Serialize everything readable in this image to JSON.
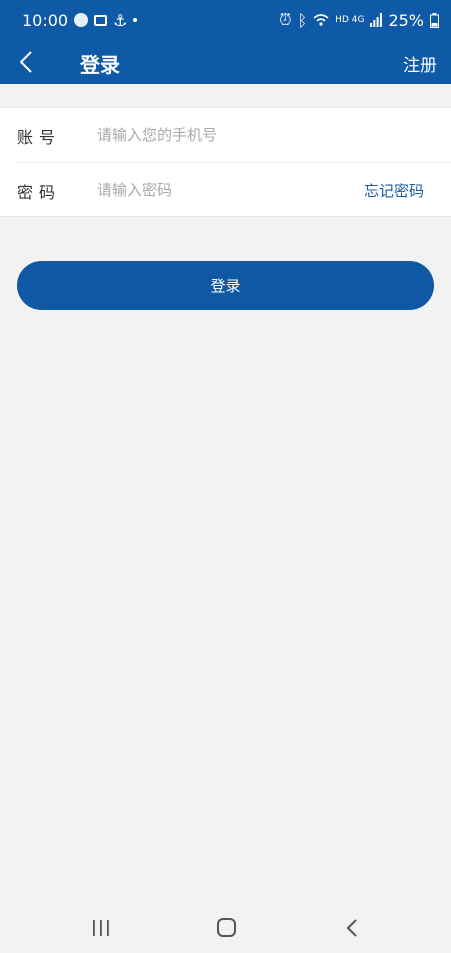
{
  "status_bar": {
    "time": "10:00",
    "network": "HD 4G",
    "battery": "25%"
  },
  "app_bar": {
    "title": "登录",
    "right_action": "注册"
  },
  "form": {
    "account": {
      "label": "账号",
      "placeholder": "请输入您的手机号"
    },
    "password": {
      "label": "密码",
      "placeholder": "请输入密码",
      "forgot": "忘记密码"
    }
  },
  "login_button": "登录",
  "colors": {
    "primary": "#0f5aa6",
    "link": "#1a5ea0",
    "background": "#f2f2f2"
  },
  "icons": {
    "back": "chevron-left-icon",
    "recent_apps": "recent-apps-icon",
    "home": "home-icon",
    "nav_back": "nav-back-icon"
  }
}
